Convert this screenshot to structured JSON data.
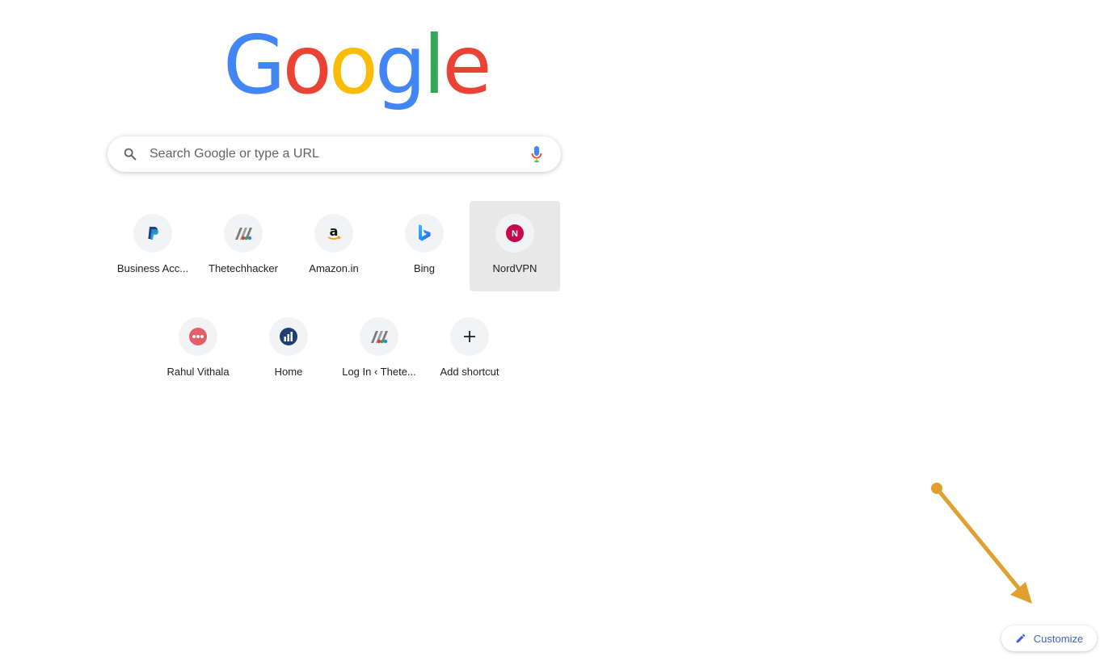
{
  "logo": {
    "letters": [
      "G",
      "o",
      "o",
      "g",
      "l",
      "e"
    ],
    "colors": [
      "#4285f4",
      "#ea4335",
      "#fbbc05",
      "#4285f4",
      "#34a853",
      "#ea4335"
    ]
  },
  "search": {
    "placeholder": "Search Google or type a URL",
    "value": "",
    "icons": [
      "search-icon",
      "microphone-icon"
    ]
  },
  "shortcuts": [
    {
      "label": "Business Acc...",
      "icon": "paypal-icon",
      "highlighted": false
    },
    {
      "label": "Thetechhacker",
      "icon": "thetechhacker-icon",
      "highlighted": false
    },
    {
      "label": "Amazon.in",
      "icon": "amazon-icon",
      "highlighted": false
    },
    {
      "label": "Bing",
      "icon": "bing-icon",
      "highlighted": false
    },
    {
      "label": "NordVPN",
      "icon": "nordvpn-icon",
      "icon_text": "N",
      "highlighted": true
    },
    {
      "label": "Rahul Vithala",
      "icon": "dots-icon",
      "highlighted": false
    },
    {
      "label": "Home",
      "icon": "home-site-icon",
      "highlighted": false
    },
    {
      "label": "Log In ‹ Thete...",
      "icon": "thetechhacker-icon",
      "highlighted": false
    },
    {
      "label": "Add shortcut",
      "icon": "plus-icon",
      "highlighted": false
    }
  ],
  "customize": {
    "label": "Customize",
    "icon": "pencil-icon",
    "color": "#3c5fd8"
  },
  "annotation": {
    "color": "#e0a030"
  }
}
